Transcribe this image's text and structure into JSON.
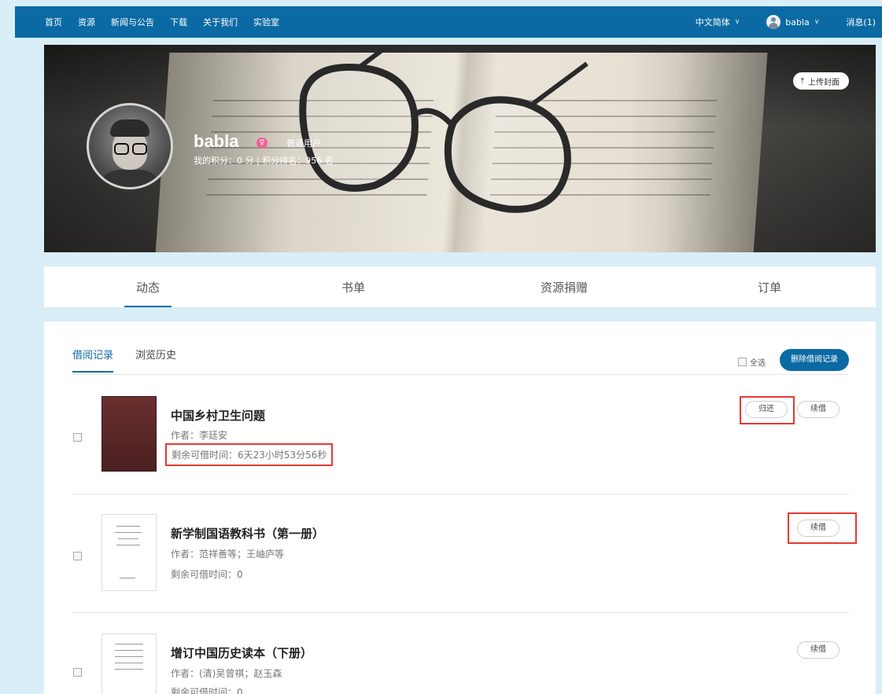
{
  "topbar": {
    "nav": [
      "首页",
      "资源",
      "新闻与公告",
      "下载",
      "关于我们",
      "实验室"
    ],
    "language": "中文简体",
    "username": "babla",
    "messages": "消息(1)"
  },
  "profile": {
    "name": "babla",
    "role": "普通用户",
    "score_line": "我的积分：0 分 | 积分排名：956 名",
    "upload_cover": "上传封面"
  },
  "tabs": [
    "动态",
    "书单",
    "资源捐赠",
    "订单"
  ],
  "panel": {
    "subtabs": [
      "借阅记录",
      "浏览历史"
    ],
    "select_all": "全选",
    "delete_button": "删除借阅记录",
    "items": [
      {
        "title": "中国乡村卫生问题",
        "author": "作者：李廷安",
        "remaining": "剩余可借时间：6天23小时53分56秒",
        "return_label": "归还",
        "renew_label": "续借"
      },
      {
        "title": "新学制国语教科书（第一册）",
        "author": "作者：范祥善等；王岫庐等",
        "remaining": "剩余可借时间：0",
        "renew_label": "续借"
      },
      {
        "title": "增订中国历史读本（下册）",
        "author": "作者：(清)吴曾祺；赵玉森",
        "remaining": "剩余可借时间：0",
        "renew_label": "续借"
      }
    ]
  },
  "colors": {
    "primary": "#0b6aa3",
    "highlight": "#e53935"
  }
}
